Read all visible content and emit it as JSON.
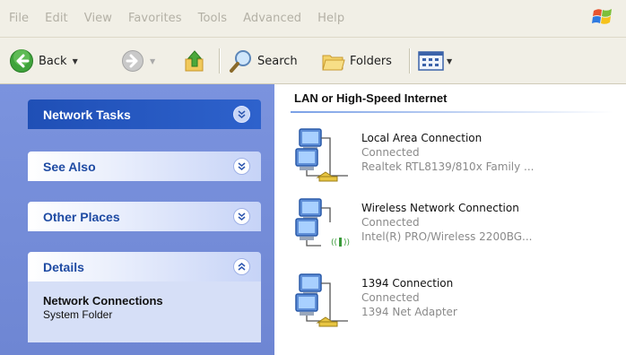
{
  "menu": {
    "items": [
      "File",
      "Edit",
      "View",
      "Favorites",
      "Tools",
      "Advanced",
      "Help"
    ]
  },
  "toolbar": {
    "back_label": "Back",
    "search_label": "Search",
    "folders_label": "Folders"
  },
  "taskpane": {
    "network_tasks": "Network Tasks",
    "see_also": "See Also",
    "other_places": "Other Places",
    "details": {
      "title": "Details",
      "name": "Network Connections",
      "type": "System Folder"
    }
  },
  "content": {
    "section_title": "LAN or High-Speed Internet",
    "connections": [
      {
        "name": "Local Area Connection",
        "status": "Connected",
        "device": "Realtek RTL8139/810x Family ...",
        "icon": "lan-connection-icon"
      },
      {
        "name": "Wireless Network Connection",
        "status": "Connected",
        "device": "Intel(R) PRO/Wireless 2200BG...",
        "icon": "wireless-connection-icon"
      },
      {
        "name": "1394 Connection",
        "status": "Connected",
        "device": "1394 Net Adapter",
        "icon": "1394-connection-icon"
      }
    ]
  },
  "colors": {
    "taskpane_bg": "#7b93de",
    "task_header_dark": "#1f4fb6",
    "task_body": "#d6dff7",
    "title_blue": "#1f4ba3",
    "menu_disabled": "#b3b0a5"
  }
}
